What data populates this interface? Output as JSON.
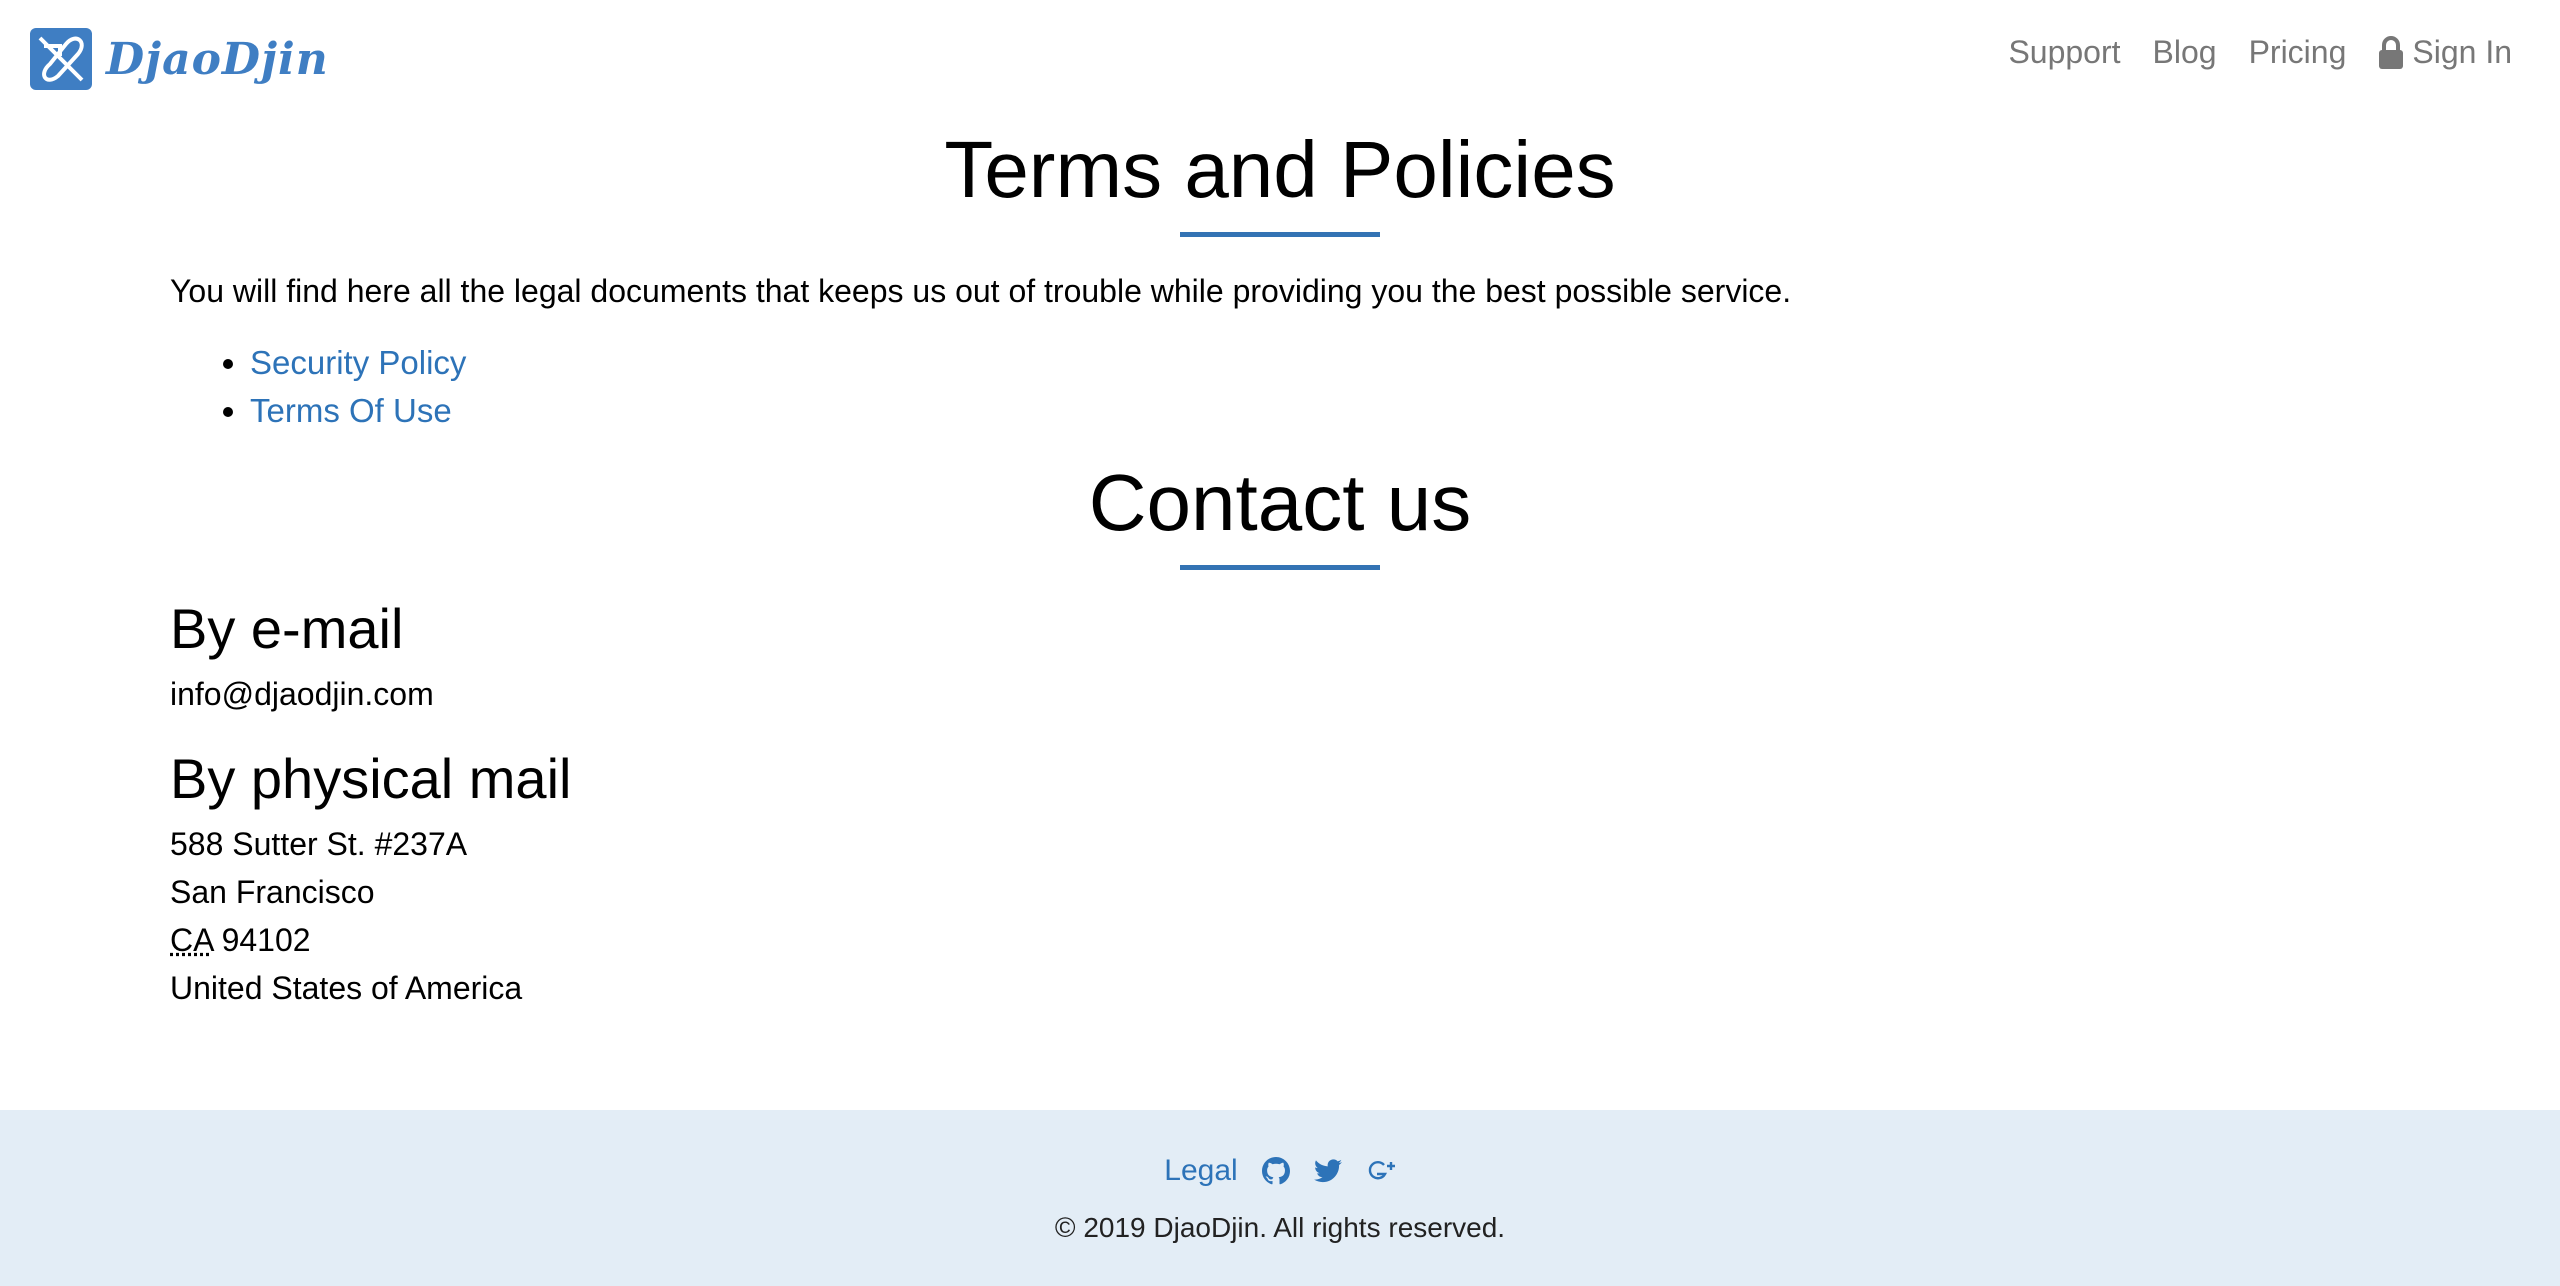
{
  "header": {
    "brand": "DjaoDjin",
    "nav": {
      "support": "Support",
      "blog": "Blog",
      "pricing": "Pricing",
      "signin": "Sign In"
    }
  },
  "terms": {
    "title": "Terms and Policies",
    "intro": "You will find here all the legal documents that keeps us out of trouble while providing you the best possible service.",
    "links": [
      "Security Policy",
      "Terms Of Use"
    ]
  },
  "contact": {
    "title": "Contact us",
    "email_heading": "By e-mail",
    "email": "info@djaodjin.com",
    "mail_heading": "By physical mail",
    "address": {
      "street": "588 Sutter St. #237A",
      "city": "San Francisco",
      "state": "CA",
      "zip": " 94102",
      "country": "United States of America"
    }
  },
  "footer": {
    "legal": "Legal",
    "icons": [
      "github-icon",
      "twitter-icon",
      "google-plus-icon"
    ],
    "copyright": "© 2019 DjaoDjin. All rights reserved."
  },
  "colors": {
    "brand": "#3f7ec3",
    "link": "#2d73b8",
    "footer_bg": "#e3edf6",
    "nav_text": "#777777"
  }
}
